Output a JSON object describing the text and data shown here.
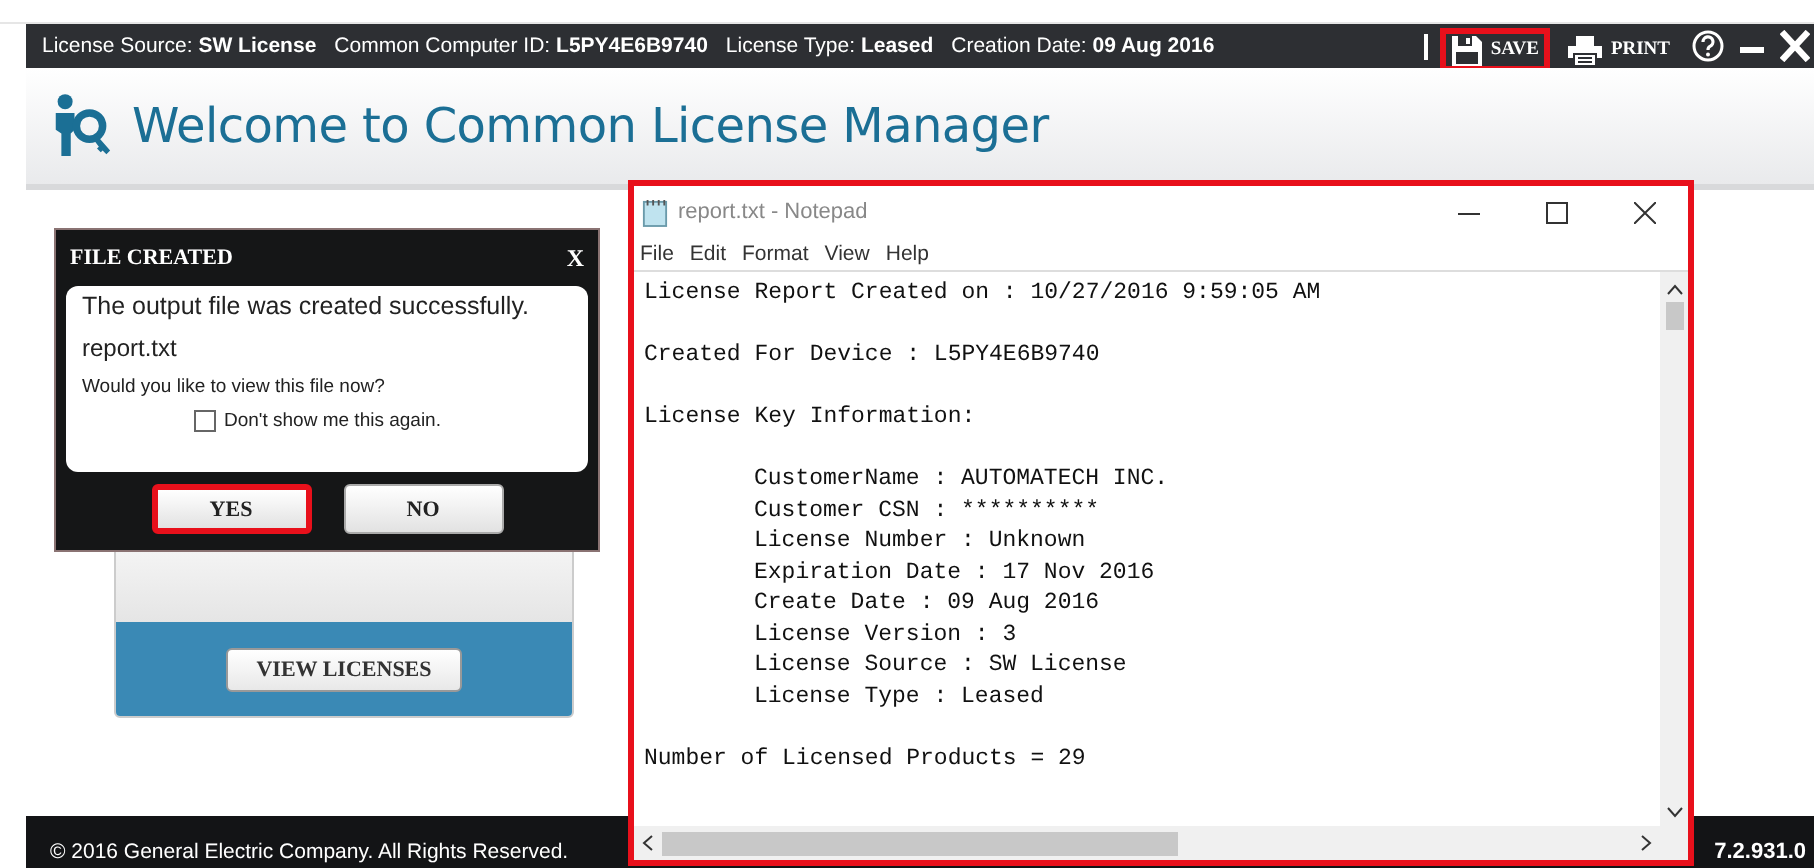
{
  "header": {
    "info": [
      {
        "label": "License Source:",
        "value": "SW License"
      },
      {
        "label": "Common Computer ID:",
        "value": "L5PY4E6B9740"
      },
      {
        "label": "License Type:",
        "value": "Leased"
      },
      {
        "label": "Creation Date:",
        "value": "09 Aug 2016"
      }
    ],
    "actions": [
      {
        "kind": "save",
        "label": "SAVE",
        "highlighted": true
      },
      {
        "kind": "print",
        "label": "PRINT",
        "highlighted": false
      },
      {
        "kind": "help",
        "highlighted": false
      },
      {
        "kind": "minimize",
        "highlighted": false
      },
      {
        "kind": "close",
        "highlighted": false
      }
    ]
  },
  "app_title": "Welcome to Common License Manager",
  "card": {
    "button": "VIEW LICENSES"
  },
  "footer": {
    "copyright": "© 2016 General Electric Company.  All Rights Reserved.",
    "version": "7.2.931.0"
  },
  "dialog": {
    "title": "FILE CREATED",
    "close": "X",
    "message": "The output file was created successfully.",
    "file": "report.txt",
    "question": "Would you like to view this file now?",
    "checkbox": {
      "label": "Don't show me this again.",
      "checked": false
    },
    "buttons": [
      {
        "label": "YES",
        "highlighted": true
      },
      {
        "label": "NO",
        "highlighted": false
      }
    ]
  },
  "notepad": {
    "title": "report.txt - Notepad",
    "highlighted": true,
    "menu": [
      "File",
      "Edit",
      "Format",
      "View",
      "Help"
    ],
    "blocks": [
      {
        "indented": false,
        "lines": [
          "License Report Created on : 10/27/2016 9:59:05 AM"
        ]
      },
      {
        "indented": false,
        "lines": [
          "Created For Device : L5PY4E6B9740"
        ]
      },
      {
        "indented": false,
        "lines": [
          "License Key Information:"
        ]
      },
      {
        "indented": true,
        "lines": [
          "CustomerName : AUTOMATECH INC.",
          "Customer CSN : **********",
          "License Number : Unknown",
          "Expiration Date : 17 Nov 2016",
          "Create Date : 09 Aug 2016",
          "License Version : 3",
          "License Source : SW License",
          "License Type : Leased"
        ]
      },
      {
        "indented": false,
        "lines": [
          "Number of Licensed Products = 29"
        ]
      }
    ]
  }
}
